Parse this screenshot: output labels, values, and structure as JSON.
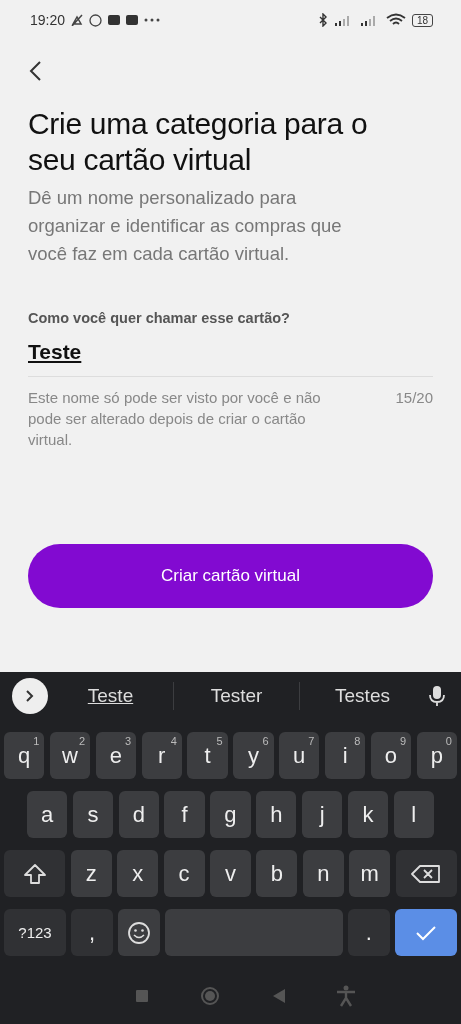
{
  "status_bar": {
    "time": "19:20",
    "battery": "18"
  },
  "title": "Crie uma categoria para o seu cartão virtual",
  "subtitle": "Dê um nome personalizado para organizar e identificar as compras que você faz em cada cartão virtual.",
  "name_field": {
    "label": "Como você quer chamar esse cartão?",
    "value": "Teste",
    "helper": "Este nome só pode ser visto por você e não pode ser alterado depois de criar o cartão virtual.",
    "counter": "15/20"
  },
  "primary_button": "Criar cartão virtual",
  "keyboard": {
    "suggestions": [
      {
        "text": "Teste",
        "selected": true
      },
      {
        "text": "Tester",
        "selected": false
      },
      {
        "text": "Testes",
        "selected": false
      }
    ],
    "rows": [
      {
        "keys": [
          {
            "kind": "letter",
            "label": "q",
            "hint": "1"
          },
          {
            "kind": "letter",
            "label": "w",
            "hint": "2"
          },
          {
            "kind": "letter",
            "label": "e",
            "hint": "3"
          },
          {
            "kind": "letter",
            "label": "r",
            "hint": "4"
          },
          {
            "kind": "letter",
            "label": "t",
            "hint": "5"
          },
          {
            "kind": "letter",
            "label": "y",
            "hint": "6"
          },
          {
            "kind": "letter",
            "label": "u",
            "hint": "7"
          },
          {
            "kind": "letter",
            "label": "i",
            "hint": "8"
          },
          {
            "kind": "letter",
            "label": "o",
            "hint": "9"
          },
          {
            "kind": "letter",
            "label": "p",
            "hint": "0"
          }
        ]
      },
      {
        "keys": [
          {
            "kind": "letter",
            "label": "a"
          },
          {
            "kind": "letter",
            "label": "s"
          },
          {
            "kind": "letter",
            "label": "d"
          },
          {
            "kind": "letter",
            "label": "f"
          },
          {
            "kind": "letter",
            "label": "g"
          },
          {
            "kind": "letter",
            "label": "h"
          },
          {
            "kind": "letter",
            "label": "j"
          },
          {
            "kind": "letter",
            "label": "k"
          },
          {
            "kind": "letter",
            "label": "l"
          }
        ]
      },
      {
        "keys": [
          {
            "kind": "shift"
          },
          {
            "kind": "letter",
            "label": "z"
          },
          {
            "kind": "letter",
            "label": "x"
          },
          {
            "kind": "letter",
            "label": "c"
          },
          {
            "kind": "letter",
            "label": "v"
          },
          {
            "kind": "letter",
            "label": "b"
          },
          {
            "kind": "letter",
            "label": "n"
          },
          {
            "kind": "letter",
            "label": "m"
          },
          {
            "kind": "backspace"
          }
        ]
      },
      {
        "keys": [
          {
            "kind": "symbols",
            "label": "?123"
          },
          {
            "kind": "punct",
            "label": ","
          },
          {
            "kind": "emoji"
          },
          {
            "kind": "space"
          },
          {
            "kind": "punct",
            "label": "."
          },
          {
            "kind": "enter"
          }
        ]
      }
    ]
  }
}
